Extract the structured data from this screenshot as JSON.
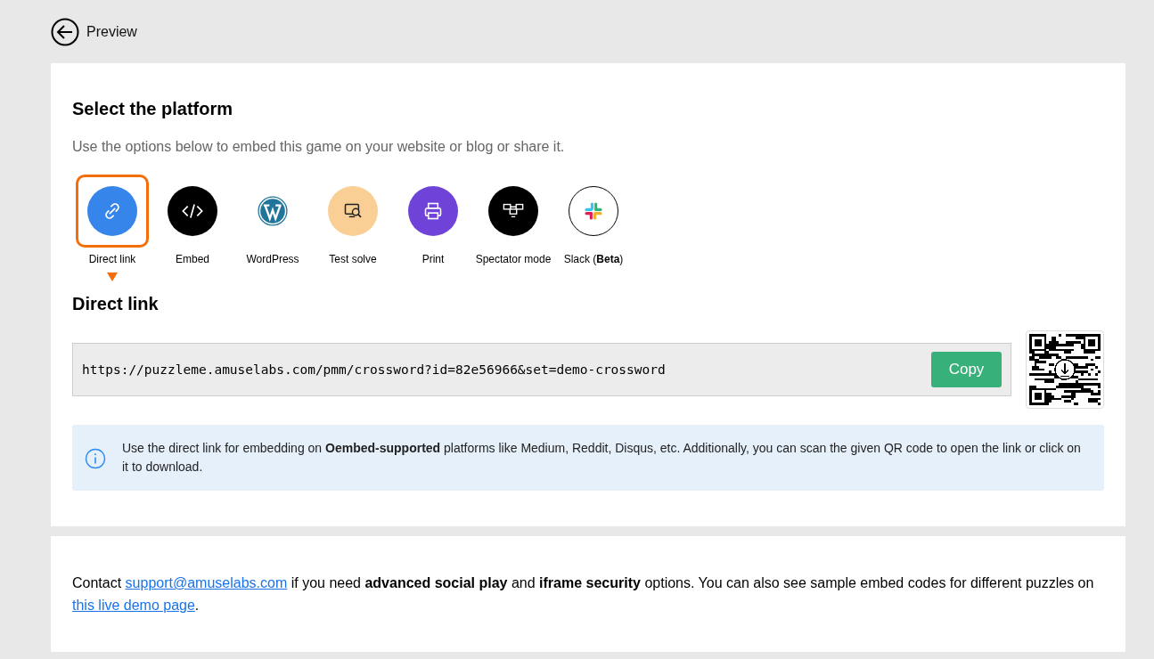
{
  "back": {
    "label": "Preview"
  },
  "platform": {
    "title": "Select the platform",
    "subtitle": "Use the options below to embed this game on your website or blog or share it.",
    "options": [
      {
        "kind": "link",
        "label": "Direct link",
        "selected": true
      },
      {
        "kind": "embed",
        "label": "Embed",
        "selected": false
      },
      {
        "kind": "wordpress",
        "label": "WordPress",
        "selected": false
      },
      {
        "kind": "testsolve",
        "label": "Test solve",
        "selected": false
      },
      {
        "kind": "print",
        "label": "Print",
        "selected": false
      },
      {
        "kind": "spectator",
        "label": "Spectator mode",
        "selected": false
      },
      {
        "kind": "slack",
        "label": "Slack (**Beta**)",
        "selected": false
      }
    ]
  },
  "direct_link": {
    "title": "Direct link",
    "url": "https://puzzleme.amuselabs.com/pmm/crossword?id=82e56966&set=demo-crossword",
    "copy_button": "Copy",
    "info": "Use the direct link for embedding on **Oembed-supported** platforms like Medium, Reddit, Disqus, etc. Additionally, you can scan the given QR code to open the link or click on it to download."
  },
  "footer": {
    "parts": [
      {
        "kind": "text",
        "text": "Contact "
      },
      {
        "kind": "link",
        "text": "support@amuselabs.com"
      },
      {
        "kind": "text",
        "text": " if you need **advanced social play** and **iframe security** options. You can also see sample embed codes for different puzzles on "
      },
      {
        "kind": "link",
        "text": "this live demo page"
      },
      {
        "kind": "text",
        "text": "."
      }
    ]
  }
}
